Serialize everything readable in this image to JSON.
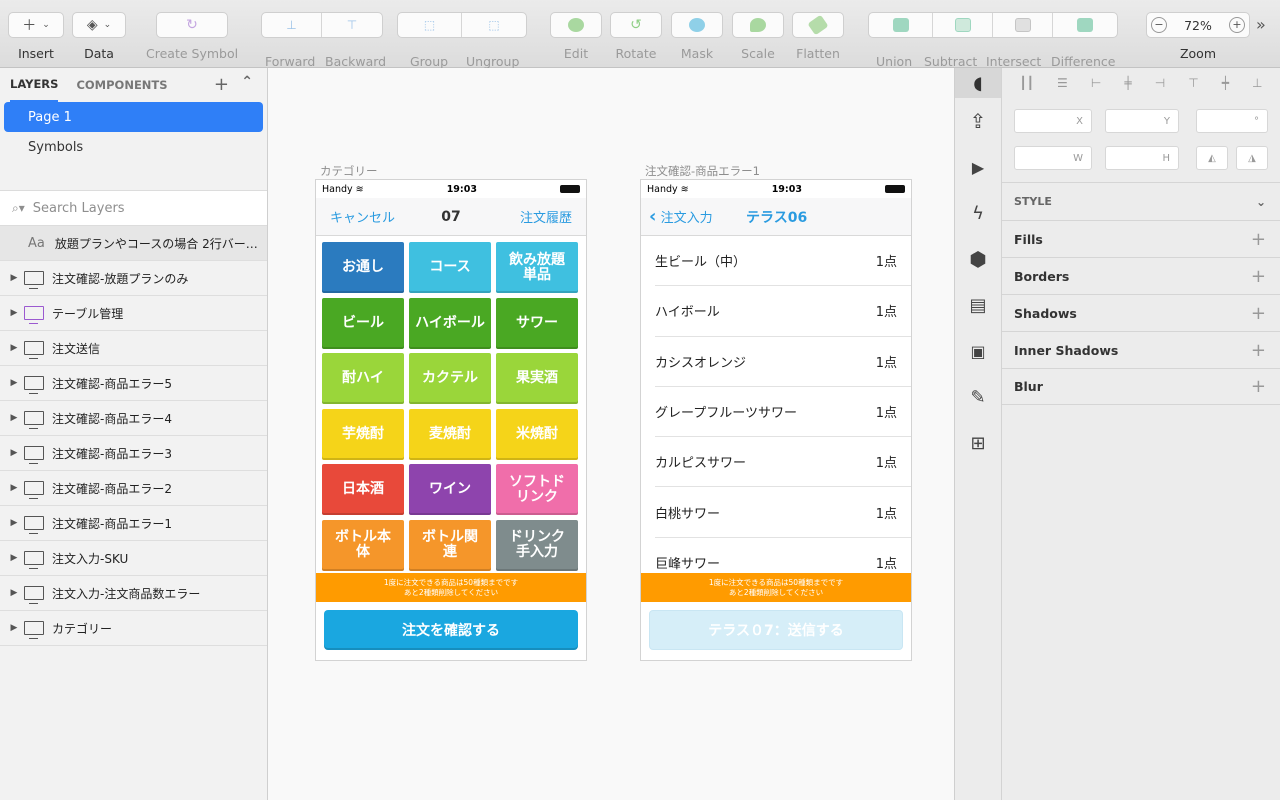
{
  "toolbar": {
    "insert": "Insert",
    "data": "Data",
    "create_symbol": "Create Symbol",
    "forward": "Forward",
    "backward": "Backward",
    "group": "Group",
    "ungroup": "Ungroup",
    "edit": "Edit",
    "rotate": "Rotate",
    "mask": "Mask",
    "scale": "Scale",
    "flatten": "Flatten",
    "union": "Union",
    "subtract": "Subtract",
    "intersect": "Intersect",
    "difference": "Difference",
    "zoom_label": "Zoom",
    "zoom_value": "72%",
    "zoom_minus": "−",
    "zoom_plus": "+",
    "more": "»"
  },
  "left_panel": {
    "tab_layers": "LAYERS",
    "tab_components": "COMPONENTS",
    "add": "+",
    "collapse": "⌃",
    "pages": [
      "Page 1",
      "Symbols"
    ],
    "search_placeholder": "Search Layers",
    "text_layer": {
      "prefix": "Aa",
      "name": "放題プランやコースの場合 2行バー…"
    },
    "layers": [
      "注文確認-放題プランのみ",
      "テーブル管理",
      "注文送信",
      "注文確認-商品エラー5",
      "注文確認-商品エラー4",
      "注文確認-商品エラー3",
      "注文確認-商品エラー2",
      "注文確認-商品エラー1",
      "注文入力-SKU",
      "注文入力-注文商品数エラー",
      "カテゴリー"
    ]
  },
  "artboard1": {
    "title": "カテゴリー",
    "status": {
      "carrier": "Handy",
      "time": "19:03"
    },
    "nav": {
      "left": "キャンセル",
      "center": "07",
      "right": "注文履歴"
    },
    "categories": [
      {
        "label": "お通し",
        "color": "#2b7bbf"
      },
      {
        "label": "コース",
        "color": "#3fc0e0"
      },
      {
        "label": "飲み放題\n単品",
        "color": "#3fc0e0"
      },
      {
        "label": "ビール",
        "color": "#4aa823"
      },
      {
        "label": "ハイボール",
        "color": "#4aa823"
      },
      {
        "label": "サワー",
        "color": "#4aa823"
      },
      {
        "label": "酎ハイ",
        "color": "#9ad63a"
      },
      {
        "label": "カクテル",
        "color": "#9ad63a"
      },
      {
        "label": "果実酒",
        "color": "#9ad63a"
      },
      {
        "label": "芋焼酎",
        "color": "#f5d419"
      },
      {
        "label": "麦焼酎",
        "color": "#f5d419"
      },
      {
        "label": "米焼酎",
        "color": "#f5d419"
      },
      {
        "label": "日本酒",
        "color": "#e8493a"
      },
      {
        "label": "ワイン",
        "color": "#8e44ad"
      },
      {
        "label": "ソフトド\nリンク",
        "color": "#f06eaa"
      },
      {
        "label": "ボトル本\n体",
        "color": "#f5962a"
      },
      {
        "label": "ボトル関\n連",
        "color": "#f5962a"
      },
      {
        "label": "ドリンク\n手入力",
        "color": "#7f8c8d"
      }
    ],
    "banner_line1": "1度に注文できる商品は50種類までです",
    "banner_line2": "あと2種類削除してください",
    "confirm_button": "注文を確認する"
  },
  "artboard2": {
    "title": "注文確認-商品エラー1",
    "status": {
      "carrier": "Handy",
      "time": "19:03"
    },
    "nav": {
      "back": "注文入力",
      "title": "テラス06"
    },
    "items": [
      {
        "name": "生ビール（中）",
        "qty": "1点"
      },
      {
        "name": "ハイボール",
        "qty": "1点"
      },
      {
        "name": "カシスオレンジ",
        "qty": "1点"
      },
      {
        "name": "グレープフルーツサワー",
        "qty": "1点"
      },
      {
        "name": "カルピスサワー",
        "qty": "1点"
      },
      {
        "name": "白桃サワー",
        "qty": "1点"
      },
      {
        "name": "巨峰サワー",
        "qty": "1点"
      }
    ],
    "banner_line1": "1度に注文できる商品は50種類までです",
    "banner_line2": "あと2種類削除してください",
    "send_button": "テラス０7：送信する"
  },
  "inspector": {
    "x_label": "X",
    "y_label": "Y",
    "deg_label": "°",
    "w_label": "W",
    "h_label": "H",
    "style_header": "STYLE",
    "sections": [
      "Fills",
      "Borders",
      "Shadows",
      "Inner Shadows",
      "Blur"
    ]
  }
}
